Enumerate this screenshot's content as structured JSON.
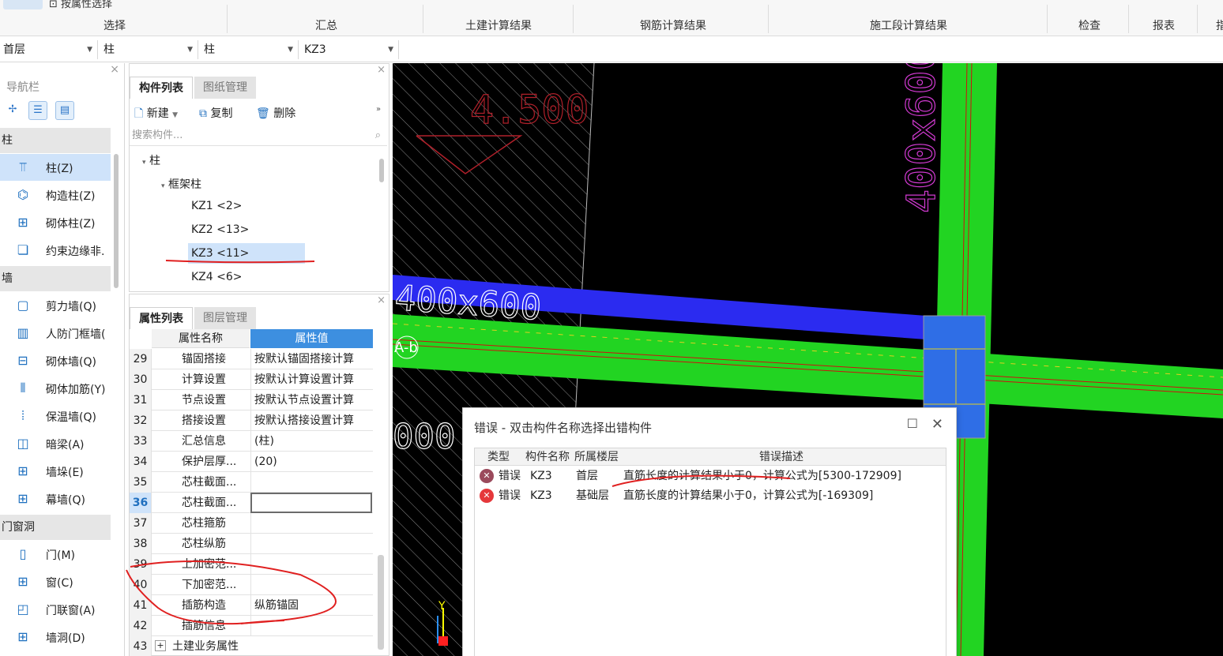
{
  "ribbon": {
    "top_tool": "按属性选择",
    "groups": [
      "选择",
      "汇总",
      "土建计算结果",
      "钢筋计算结果",
      "施工段计算结果",
      "检查",
      "报表",
      "指"
    ]
  },
  "selectors": [
    "首层",
    "柱",
    "柱",
    "KZ3"
  ],
  "nav": {
    "title": "导航栏",
    "close": "×",
    "categories": [
      {
        "label": "柱",
        "items": [
          {
            "icon": "column-icon",
            "label": "柱(Z)",
            "selected": true
          },
          {
            "icon": "construction-column-icon",
            "label": "构造柱(Z)"
          },
          {
            "icon": "masonry-column-icon",
            "label": "砌体柱(Z)"
          },
          {
            "icon": "edge-member-icon",
            "label": "约束边缘非."
          }
        ]
      },
      {
        "label": "墙",
        "items": [
          {
            "icon": "shear-wall-icon",
            "label": "剪力墙(Q)"
          },
          {
            "icon": "civil-defense-door-icon",
            "label": "人防门框墙("
          },
          {
            "icon": "masonry-wall-icon",
            "label": "砌体墙(Q)"
          },
          {
            "icon": "masonry-rebar-icon",
            "label": "砌体加筋(Y)"
          },
          {
            "icon": "insulation-wall-icon",
            "label": "保温墙(Q)"
          },
          {
            "icon": "hidden-beam-icon",
            "label": "暗梁(A)"
          },
          {
            "icon": "wall-pier-icon",
            "label": "墙垛(E)"
          },
          {
            "icon": "curtain-wall-icon",
            "label": "幕墙(Q)"
          }
        ]
      },
      {
        "label": "门窗洞",
        "items": [
          {
            "icon": "door-icon",
            "label": "门(M)"
          },
          {
            "icon": "window-icon",
            "label": "窗(C)"
          },
          {
            "icon": "door-window-icon",
            "label": "门联窗(A)"
          },
          {
            "icon": "wall-opening-icon",
            "label": "墙洞(D)"
          }
        ]
      }
    ]
  },
  "component_panel": {
    "tabs": [
      "构件列表",
      "图纸管理"
    ],
    "toolbar": {
      "new": "新建",
      "copy": "复制",
      "delete": "删除"
    },
    "search_placeholder": "搜索构件...",
    "tree": {
      "root": "柱",
      "group": "框架柱",
      "items": [
        "KZ1 <2>",
        "KZ2 <13>",
        "KZ3 <11>",
        "KZ4 <6>"
      ],
      "selected": "KZ3 <11>"
    }
  },
  "property_panel": {
    "tabs": [
      "属性列表",
      "图层管理"
    ],
    "headers": {
      "name": "属性名称",
      "value": "属性值"
    },
    "rows": [
      {
        "num": "29",
        "name": "锚固搭接",
        "value": "按默认锚固搭接计算"
      },
      {
        "num": "30",
        "name": "计算设置",
        "value": "按默认计算设置计算"
      },
      {
        "num": "31",
        "name": "节点设置",
        "value": "按默认节点设置计算"
      },
      {
        "num": "32",
        "name": "搭接设置",
        "value": "按默认搭接设置计算"
      },
      {
        "num": "33",
        "name": "汇总信息",
        "value": "(柱)"
      },
      {
        "num": "34",
        "name": "保护层厚...",
        "value": "(20)"
      },
      {
        "num": "35",
        "name": "芯柱截面...",
        "value": ""
      },
      {
        "num": "36",
        "name": "芯柱截面...",
        "value": "",
        "active": true
      },
      {
        "num": "37",
        "name": "芯柱箍筋",
        "value": ""
      },
      {
        "num": "38",
        "name": "芯柱纵筋",
        "value": ""
      },
      {
        "num": "39",
        "name": "上加密范...",
        "value": ""
      },
      {
        "num": "40",
        "name": "下加密范...",
        "value": ""
      },
      {
        "num": "41",
        "name": "插筋构造",
        "value": "纵筋锚固"
      },
      {
        "num": "42",
        "name": "插筋信息",
        "value": ""
      },
      {
        "num": "43",
        "name": "土建业务属性",
        "value": "",
        "group": true
      }
    ]
  },
  "cad": {
    "elevation": "4.500",
    "vertical_label": "400x600",
    "beam_label": "400x600",
    "axis_label": "A-b",
    "partial_label": "000",
    "colors": {
      "green": "#22d422",
      "blue": "#2b2bf0",
      "column": "#2f6ee6",
      "magenta": "#d23ad2"
    }
  },
  "error_dialog": {
    "title": "错误 - 双击构件名称选择出错构件",
    "maximize": "☐",
    "close": "✕",
    "headers": {
      "type": "类型",
      "name": "构件名称",
      "floor": "所属楼层",
      "desc": "错误描述"
    },
    "rows": [
      {
        "icon": "error-icon",
        "type": "错误",
        "name": "KZ3",
        "floor": "首层",
        "desc": "直筋长度的计算结果小于0，计算公式为[5300-172909]"
      },
      {
        "icon": "error-icon",
        "type": "错误",
        "name": "KZ3",
        "floor": "基础层",
        "desc": "直筋长度的计算结果小于0，计算公式为[-169309]"
      }
    ]
  }
}
